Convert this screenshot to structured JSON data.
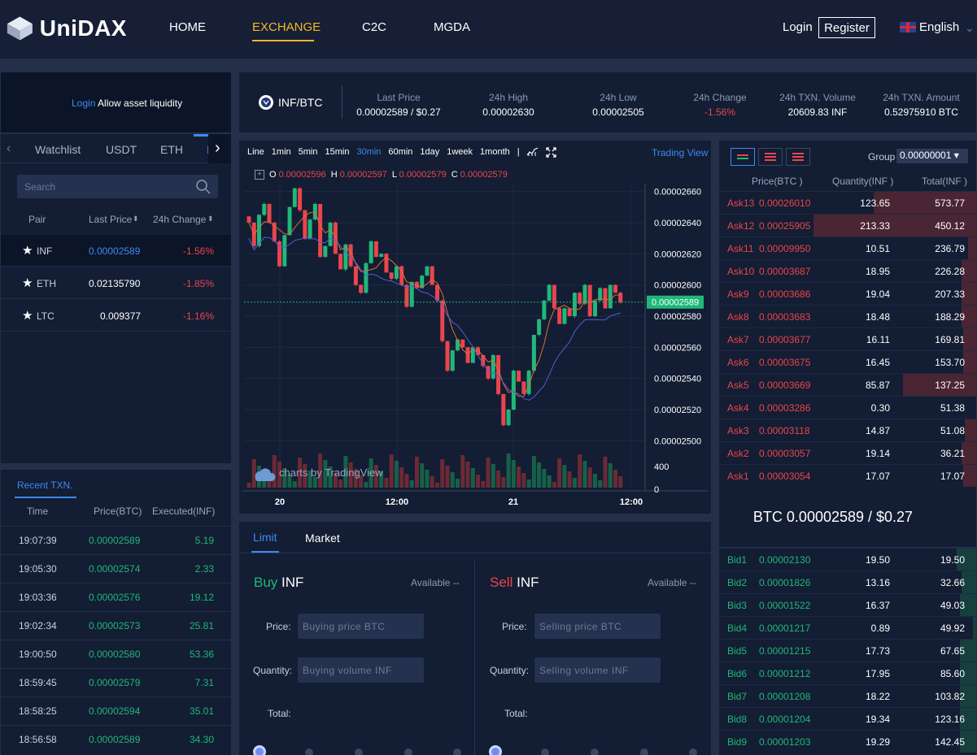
{
  "header": {
    "brand": "UniDAX",
    "nav": [
      "HOME",
      "EXCHANGE",
      "C2C",
      "MGDA"
    ],
    "active_nav": "EXCHANGE",
    "login": "Login",
    "register": "Register",
    "language": "English"
  },
  "left": {
    "login_link": "Login",
    "login_text": " Allow asset liquidity",
    "tabs": [
      "Watchlist",
      "USDT",
      "ETH",
      "B"
    ],
    "search_placeholder": "Search",
    "col_pair": "Pair",
    "col_last": "Last Price",
    "col_change": "24h Change",
    "pairs": [
      {
        "name": "INF",
        "price": "0.00002589",
        "change": "-1.56%"
      },
      {
        "name": "ETH",
        "price": "0.02135790",
        "change": "-1.85%"
      },
      {
        "name": "LTC",
        "price": "0.009377",
        "change": "-1.16%"
      }
    ]
  },
  "recent": {
    "tab": "Recent TXN.",
    "col_time": "Time",
    "col_price": "Price(BTC)",
    "col_exec": "Executed(INF)",
    "rows": [
      {
        "time": "19:07:39",
        "price": "0.00002589",
        "qty": "5.19"
      },
      {
        "time": "19:05:30",
        "price": "0.00002574",
        "qty": "2.33"
      },
      {
        "time": "19:03:36",
        "price": "0.00002576",
        "qty": "19.12"
      },
      {
        "time": "19:02:34",
        "price": "0.00002573",
        "qty": "25.81"
      },
      {
        "time": "19:00:50",
        "price": "0.00002580",
        "qty": "53.36"
      },
      {
        "time": "18:59:45",
        "price": "0.00002579",
        "qty": "7.31"
      },
      {
        "time": "18:58:25",
        "price": "0.00002594",
        "qty": "35.01"
      },
      {
        "time": "18:56:58",
        "price": "0.00002589",
        "qty": "34.30"
      }
    ]
  },
  "ticker": {
    "pair": "INF/BTC",
    "last_price_lbl": "Last Price",
    "last_price": "0.00002589 / $0.27",
    "high_lbl": "24h High",
    "high": "0.00002630",
    "low_lbl": "24h Low",
    "low": "0.00002505",
    "change_lbl": "24h Change",
    "change": "-1.56%",
    "volume_lbl": "24h TXN. Volume",
    "volume": "20609.83 INF",
    "amount_lbl": "24h TXN. Amount",
    "amount": "0.52975910 BTC"
  },
  "chart": {
    "intervals": [
      "Line",
      "1min",
      "5min",
      "15min",
      "30min",
      "60min",
      "1day",
      "1week",
      "1month",
      "|"
    ],
    "active_interval": "30min",
    "trading_view": "Trading View",
    "ohlc": {
      "o": "0.00002596",
      "h": "0.00002597",
      "l": "0.00002579",
      "c": "0.00002579"
    },
    "watermark": "charts by TradingView",
    "current_label": "0.00002589"
  },
  "chart_data": {
    "type": "candlestick",
    "y_ticks": [
      "0.00002660",
      "0.00002640",
      "0.00002620",
      "0.00002600",
      "0.00002580",
      "0.00002560",
      "0.00002540",
      "0.00002520",
      "0.00002500"
    ],
    "x_ticks": [
      "20",
      "12:00",
      "21",
      "12:00"
    ],
    "volume_ticks": [
      "400",
      "0"
    ],
    "ylim": [
      2.495e-05,
      2.665e-05
    ],
    "current": 2.589e-05,
    "closes": [
      2.64e-05,
      2.625e-05,
      2.645e-05,
      2.652e-05,
      2.64e-05,
      2.628e-05,
      2.612e-05,
      2.632e-05,
      2.65e-05,
      2.662e-05,
      2.648e-05,
      2.63e-05,
      2.642e-05,
      2.652e-05,
      2.618e-05,
      2.625e-05,
      2.64e-05,
      2.62e-05,
      2.61e-05,
      2.626e-05,
      2.612e-05,
      2.6e-05,
      2.595e-05,
      2.614e-05,
      2.628e-05,
      2.618e-05,
      2.62e-05,
      2.608e-05,
      2.604e-05,
      2.612e-05,
      2.6e-05,
      2.586e-05,
      2.602e-05,
      2.598e-05,
      2.606e-05,
      2.612e-05,
      2.6e-05,
      2.59e-05,
      2.564e-05,
      2.545e-05,
      2.558e-05,
      2.565e-05,
      2.56e-05,
      2.55e-05,
      2.56e-05,
      2.555e-05,
      2.548e-05,
      2.54e-05,
      2.555e-05,
      2.53e-05,
      2.51e-05,
      2.52e-05,
      2.545e-05,
      2.538e-05,
      2.53e-05,
      2.545e-05,
      2.568e-05,
      2.578e-05,
      2.59e-05,
      2.6e-05,
      2.585e-05,
      2.575e-05,
      2.585e-05,
      2.58e-05,
      2.595e-05,
      2.588e-05,
      2.6e-05,
      2.58e-05,
      2.59e-05,
      2.598e-05,
      2.585e-05,
      2.6e-05,
      2.595e-05,
      2.589e-05
    ]
  },
  "form": {
    "tab_limit": "Limit",
    "tab_market": "Market",
    "buy": "Buy",
    "sell": "Sell",
    "asset": "INF",
    "available": "Available --",
    "price_lbl": "Price:",
    "qty_lbl": "Quantity:",
    "total_lbl": "Total:",
    "buy_price_ph": "Buying price BTC",
    "buy_qty_ph": "Buying volume INF",
    "sell_price_ph": "Selling price BTC",
    "sell_qty_ph": "Selling volume INF"
  },
  "orderbook": {
    "group_lbl": "Group",
    "group_val": "0.00000001 ▾",
    "col_price": "Price(BTC )",
    "col_qty": "Quantity(INF )",
    "col_total": "Total(INF )",
    "asks": [
      {
        "label": "Ask13",
        "price": "0.00026010",
        "qty": "123.65",
        "total": "573.77",
        "depth": 0.63
      },
      {
        "label": "Ask12",
        "price": "0.00025905",
        "qty": "213.33",
        "total": "450.12",
        "depth": 1.0
      },
      {
        "label": "Ask11",
        "price": "0.00009950",
        "qty": "10.51",
        "total": "236.79",
        "depth": 0.05
      },
      {
        "label": "Ask10",
        "price": "0.00003687",
        "qty": "18.95",
        "total": "226.28",
        "depth": 0.09
      },
      {
        "label": "Ask9",
        "price": "0.00003686",
        "qty": "19.04",
        "total": "207.33",
        "depth": 0.09
      },
      {
        "label": "Ask8",
        "price": "0.00003683",
        "qty": "18.48",
        "total": "188.29",
        "depth": 0.09
      },
      {
        "label": "Ask7",
        "price": "0.00003677",
        "qty": "16.11",
        "total": "169.81",
        "depth": 0.08
      },
      {
        "label": "Ask6",
        "price": "0.00003675",
        "qty": "16.45",
        "total": "153.70",
        "depth": 0.08
      },
      {
        "label": "Ask5",
        "price": "0.00003669",
        "qty": "85.87",
        "total": "137.25",
        "depth": 0.45
      },
      {
        "label": "Ask4",
        "price": "0.00003286",
        "qty": "0.30",
        "total": "51.38",
        "depth": 0.0
      },
      {
        "label": "Ask3",
        "price": "0.00003118",
        "qty": "14.87",
        "total": "51.08",
        "depth": 0.07
      },
      {
        "label": "Ask2",
        "price": "0.00003057",
        "qty": "19.14",
        "total": "36.21",
        "depth": 0.09
      },
      {
        "label": "Ask1",
        "price": "0.00003054",
        "qty": "17.07",
        "total": "17.07",
        "depth": 0.08
      }
    ],
    "mid": "BTC 0.00002589 / $0.27",
    "bids": [
      {
        "label": "Bid1",
        "price": "0.00002130",
        "qty": "19.50",
        "total": "19.50",
        "depth": 0.12
      },
      {
        "label": "Bid2",
        "price": "0.00001826",
        "qty": "13.16",
        "total": "32.66",
        "depth": 0.09
      },
      {
        "label": "Bid3",
        "price": "0.00001522",
        "qty": "16.37",
        "total": "49.03",
        "depth": 0.1
      },
      {
        "label": "Bid4",
        "price": "0.00001217",
        "qty": "0.89",
        "total": "49.92",
        "depth": 0.02
      },
      {
        "label": "Bid5",
        "price": "0.00001215",
        "qty": "17.73",
        "total": "67.65",
        "depth": 0.1
      },
      {
        "label": "Bid6",
        "price": "0.00001212",
        "qty": "17.95",
        "total": "85.60",
        "depth": 0.1
      },
      {
        "label": "Bid7",
        "price": "0.00001208",
        "qty": "18.22",
        "total": "103.82",
        "depth": 0.1
      },
      {
        "label": "Bid8",
        "price": "0.00001204",
        "qty": "19.34",
        "total": "123.16",
        "depth": 0.1
      },
      {
        "label": "Bid9",
        "price": "0.00001203",
        "qty": "19.29",
        "total": "142.45",
        "depth": 0.1
      }
    ]
  }
}
